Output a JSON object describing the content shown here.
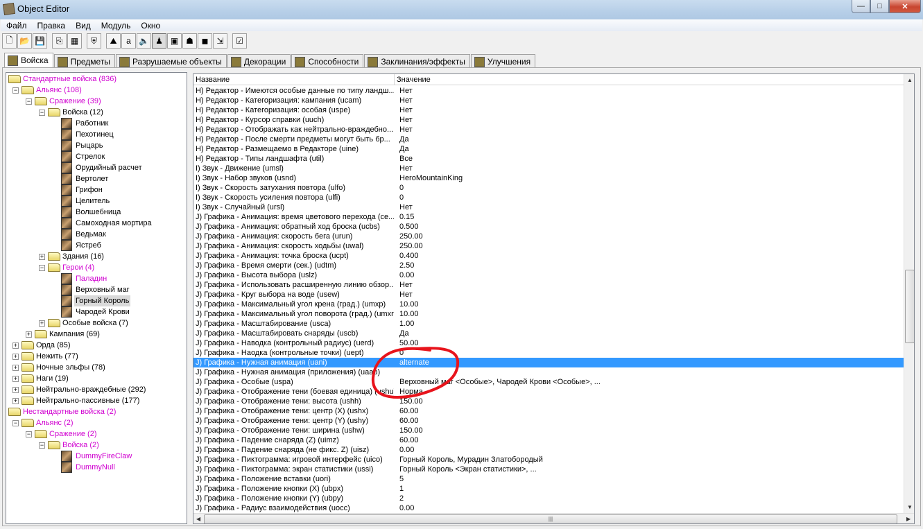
{
  "window": {
    "title": "Object Editor",
    "minimize": "—",
    "maximize": "□",
    "close": "✕"
  },
  "menu": [
    "Файл",
    "Правка",
    "Вид",
    "Модуль",
    "Окно"
  ],
  "toolbar": [
    {
      "icon": "new-file-icon",
      "glyph": "🗋"
    },
    {
      "icon": "open-folder-icon",
      "glyph": "📂"
    },
    {
      "icon": "save-icon",
      "glyph": "💾"
    },
    {
      "icon": "copy-icon",
      "glyph": "⎘"
    },
    {
      "icon": "paste-icon",
      "glyph": "▦"
    },
    {
      "icon": "units-icon",
      "glyph": "⛨"
    },
    {
      "icon": "terrain-icon",
      "glyph": "⛰"
    },
    {
      "icon": "text-icon",
      "glyph": "a"
    },
    {
      "icon": "sound-icon",
      "glyph": "🔈"
    },
    {
      "icon": "unit-pressed-icon",
      "glyph": "♟"
    },
    {
      "icon": "item-icon",
      "glyph": "▣"
    },
    {
      "icon": "monster-icon",
      "glyph": "☗"
    },
    {
      "icon": "cube-icon",
      "glyph": "◼"
    },
    {
      "icon": "import-icon",
      "glyph": "⇲"
    },
    {
      "icon": "checklist-icon",
      "glyph": "☑"
    }
  ],
  "tabs": [
    "Войска",
    "Предметы",
    "Разрушаемые объекты",
    "Декорации",
    "Способности",
    "Заклинания/эффекты",
    "Улучшения"
  ],
  "tree": [
    {
      "label": "Стандартные войска (836)",
      "level": 0,
      "kind": "folder",
      "exp": "",
      "color": "magenta"
    },
    {
      "label": "Альянс (108)",
      "level": 1,
      "kind": "folder",
      "exp": "-",
      "color": "magenta"
    },
    {
      "label": "Сражение (39)",
      "level": 2,
      "kind": "folder",
      "exp": "-",
      "color": "magenta"
    },
    {
      "label": "Войска (12)",
      "level": 3,
      "kind": "folder",
      "exp": "-",
      "color": "black"
    },
    {
      "label": "Работник",
      "level": 4,
      "kind": "unit",
      "exp": "",
      "color": "black"
    },
    {
      "label": "Пехотинец",
      "level": 4,
      "kind": "unit",
      "exp": "",
      "color": "black"
    },
    {
      "label": "Рыцарь",
      "level": 4,
      "kind": "unit",
      "exp": "",
      "color": "black"
    },
    {
      "label": "Стрелок",
      "level": 4,
      "kind": "unit",
      "exp": "",
      "color": "black"
    },
    {
      "label": "Орудийный расчет",
      "level": 4,
      "kind": "unit",
      "exp": "",
      "color": "black"
    },
    {
      "label": "Вертолет",
      "level": 4,
      "kind": "unit",
      "exp": "",
      "color": "black"
    },
    {
      "label": "Грифон",
      "level": 4,
      "kind": "unit",
      "exp": "",
      "color": "black"
    },
    {
      "label": "Целитель",
      "level": 4,
      "kind": "unit",
      "exp": "",
      "color": "black"
    },
    {
      "label": "Волшебница",
      "level": 4,
      "kind": "unit",
      "exp": "",
      "color": "black"
    },
    {
      "label": "Самоходная мортира",
      "level": 4,
      "kind": "unit",
      "exp": "",
      "color": "black"
    },
    {
      "label": "Ведьмак",
      "level": 4,
      "kind": "unit",
      "exp": "",
      "color": "black"
    },
    {
      "label": "Ястреб",
      "level": 4,
      "kind": "unit",
      "exp": "",
      "color": "black"
    },
    {
      "label": "Здания (16)",
      "level": 3,
      "kind": "folder",
      "exp": "+",
      "color": "black"
    },
    {
      "label": "Герои (4)",
      "level": 3,
      "kind": "folder",
      "exp": "-",
      "color": "magenta"
    },
    {
      "label": "Паладин",
      "level": 4,
      "kind": "unit",
      "exp": "",
      "color": "magenta"
    },
    {
      "label": "Верховный маг",
      "level": 4,
      "kind": "unit",
      "exp": "",
      "color": "black"
    },
    {
      "label": "Горный Король",
      "level": 4,
      "kind": "unit",
      "exp": "",
      "color": "black",
      "selected": true
    },
    {
      "label": "Чародей Крови",
      "level": 4,
      "kind": "unit",
      "exp": "",
      "color": "black"
    },
    {
      "label": "Особые войска (7)",
      "level": 3,
      "kind": "folder",
      "exp": "+",
      "color": "black"
    },
    {
      "label": "Кампания (69)",
      "level": 2,
      "kind": "folder",
      "exp": "+",
      "color": "black"
    },
    {
      "label": "Орда (85)",
      "level": 1,
      "kind": "folder",
      "exp": "+",
      "color": "black"
    },
    {
      "label": "Нежить (77)",
      "level": 1,
      "kind": "folder",
      "exp": "+",
      "color": "black"
    },
    {
      "label": "Ночные эльфы (78)",
      "level": 1,
      "kind": "folder",
      "exp": "+",
      "color": "black"
    },
    {
      "label": "Наги (19)",
      "level": 1,
      "kind": "folder",
      "exp": "+",
      "color": "black"
    },
    {
      "label": "Нейтрально-враждебные (292)",
      "level": 1,
      "kind": "folder",
      "exp": "+",
      "color": "black"
    },
    {
      "label": "Нейтрально-пассивные (177)",
      "level": 1,
      "kind": "folder",
      "exp": "+",
      "color": "black"
    },
    {
      "label": "Нестандартные войска (2)",
      "level": 0,
      "kind": "folder",
      "exp": "",
      "color": "magenta"
    },
    {
      "label": "Альянс (2)",
      "level": 1,
      "kind": "folder",
      "exp": "-",
      "color": "magenta"
    },
    {
      "label": "Сражение (2)",
      "level": 2,
      "kind": "folder",
      "exp": "-",
      "color": "magenta"
    },
    {
      "label": "Войска (2)",
      "level": 3,
      "kind": "folder",
      "exp": "-",
      "color": "magenta"
    },
    {
      "label": "DummyFireClaw",
      "level": 4,
      "kind": "unit",
      "exp": "",
      "color": "magenta"
    },
    {
      "label": "DummyNull",
      "level": 4,
      "kind": "unit",
      "exp": "",
      "color": "magenta"
    }
  ],
  "table": {
    "columns": [
      "Название",
      "Значение"
    ],
    "rows": [
      {
        "name": "H) Редактор - Имеются особые данные по типу ландш...",
        "value": "Нет"
      },
      {
        "name": "H) Редактор - Категоризация: кампания (ucam)",
        "value": "Нет"
      },
      {
        "name": "H) Редактор - Категоризация: особая (uspe)",
        "value": "Нет"
      },
      {
        "name": "H) Редактор - Курсор справки (uuch)",
        "value": "Нет"
      },
      {
        "name": "H) Редактор - Отображать как нейтрально-враждебно...",
        "value": "Нет"
      },
      {
        "name": "H) Редактор - После смерти предметы могут быть бр...",
        "value": "Да"
      },
      {
        "name": "H) Редактор - Размещаемо в Редакторе (uine)",
        "value": "Да"
      },
      {
        "name": "H) Редактор - Типы ландшафта (util)",
        "value": "Все"
      },
      {
        "name": "I) Звук - Движение (umsl)",
        "value": "Нет"
      },
      {
        "name": "I) Звук - Набор звуков (usnd)",
        "value": "HeroMountainKing"
      },
      {
        "name": "I) Звук - Скорость затухания повтора (ulfo)",
        "value": "0"
      },
      {
        "name": "I) Звук - Скорость усиления повтора (ulfi)",
        "value": "0"
      },
      {
        "name": "I) Звук - Случайный (ursl)",
        "value": "Нет"
      },
      {
        "name": "J) Графика - Анимация: время цветового перехода (се...",
        "value": "0.15"
      },
      {
        "name": "J) Графика - Анимация: обратный ход броска (ucbs)",
        "value": "0.500"
      },
      {
        "name": "J) Графика - Анимация: скорость бега (urun)",
        "value": "250.00"
      },
      {
        "name": "J) Графика - Анимация: скорость ходьбы (uwal)",
        "value": "250.00"
      },
      {
        "name": "J) Графика - Анимация: точка броска (ucpt)",
        "value": "0.400"
      },
      {
        "name": "J) Графика - Время смерти (сек.) (udtm)",
        "value": "2.50"
      },
      {
        "name": "J) Графика - Высота выбора (uslz)",
        "value": "0.00"
      },
      {
        "name": "J) Графика - Использовать расширенную линию обзор...",
        "value": "Нет"
      },
      {
        "name": "J) Графика - Круг выбора на воде (usew)",
        "value": "Нет"
      },
      {
        "name": "J) Графика - Максимальный угол крена (град.) (umxp)",
        "value": "10.00"
      },
      {
        "name": "J) Графика - Максимальный угол поворота (град.) (umxr)",
        "value": "10.00"
      },
      {
        "name": "J) Графика - Масштабирование (usca)",
        "value": "1.00"
      },
      {
        "name": "J) Графика - Масштабировать снаряды (uscb)",
        "value": "Да"
      },
      {
        "name": "J) Графика - Наводка (контрольный радиус) (uerd)",
        "value": "50.00"
      },
      {
        "name": "J) Графика - Наодка (контрольные точки) (uept)",
        "value": "0"
      },
      {
        "name": "J) Графика - Нужная анимация (uani)",
        "value": "alternate",
        "selected": true
      },
      {
        "name": "J) Графика - Нужная анимация (приложения) (uaap)",
        "value": ""
      },
      {
        "name": "J) Графика - Особые (uspa)",
        "value": "Верховный маг <Особые>, Чародей Крови <Особые>, ..."
      },
      {
        "name": "J) Графика - Отображение тени (боевая единица) (ushu)",
        "value": "Норма"
      },
      {
        "name": "J) Графика - Отображение тени: высота (ushh)",
        "value": "150.00"
      },
      {
        "name": "J) Графика - Отображение тени: центр (X) (ushx)",
        "value": "60.00"
      },
      {
        "name": "J) Графика - Отображение тени: центр (Y) (ushy)",
        "value": "60.00"
      },
      {
        "name": "J) Графика - Отображение тени: ширина (ushw)",
        "value": "150.00"
      },
      {
        "name": "J) Графика - Падение снаряда (Z) (uimz)",
        "value": "60.00"
      },
      {
        "name": "J) Графика - Падение снаряда (не фикс. Z) (uisz)",
        "value": "0.00"
      },
      {
        "name": "J) Графика - Пиктограмма: игровой интерфейс (uico)",
        "value": "Горный Король, Мурадин Златобородый"
      },
      {
        "name": "J) Графика - Пиктограмма: экран статистики (ussi)",
        "value": "Горный Король <Экран статистики>, ..."
      },
      {
        "name": "J) Графика - Положение вставки (uori)",
        "value": "5"
      },
      {
        "name": "J) Графика - Положение кнопки (X) (ubpx)",
        "value": "1"
      },
      {
        "name": "J) Графика - Положение кнопки (Y) (ubpy)",
        "value": "2"
      },
      {
        "name": "J) Графика - Радиус взаимодействия (uocc)",
        "value": "0.00"
      }
    ]
  },
  "colors": {
    "selection": "#3399ff",
    "custom_item": "#d000d0",
    "annotation": "#e8141c"
  }
}
